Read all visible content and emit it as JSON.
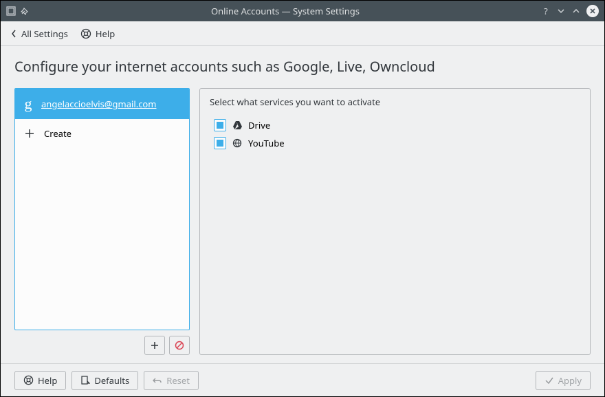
{
  "window": {
    "title": "Online Accounts — System Settings"
  },
  "toolbar": {
    "all_settings": "All Settings",
    "help": "Help"
  },
  "heading": "Configure your internet accounts such as Google, Live, Owncloud",
  "accounts": [
    {
      "provider": "google",
      "label": "angelaccioelvis@gmail.com",
      "selected": true
    }
  ],
  "create_label": "Create",
  "services": {
    "heading": "Select what services you want to activate",
    "items": [
      {
        "name": "Drive",
        "checked": true,
        "icon": "drive"
      },
      {
        "name": "YouTube",
        "checked": true,
        "icon": "youtube"
      }
    ]
  },
  "footer": {
    "help": "Help",
    "defaults": "Defaults",
    "reset": "Reset",
    "apply": "Apply"
  }
}
